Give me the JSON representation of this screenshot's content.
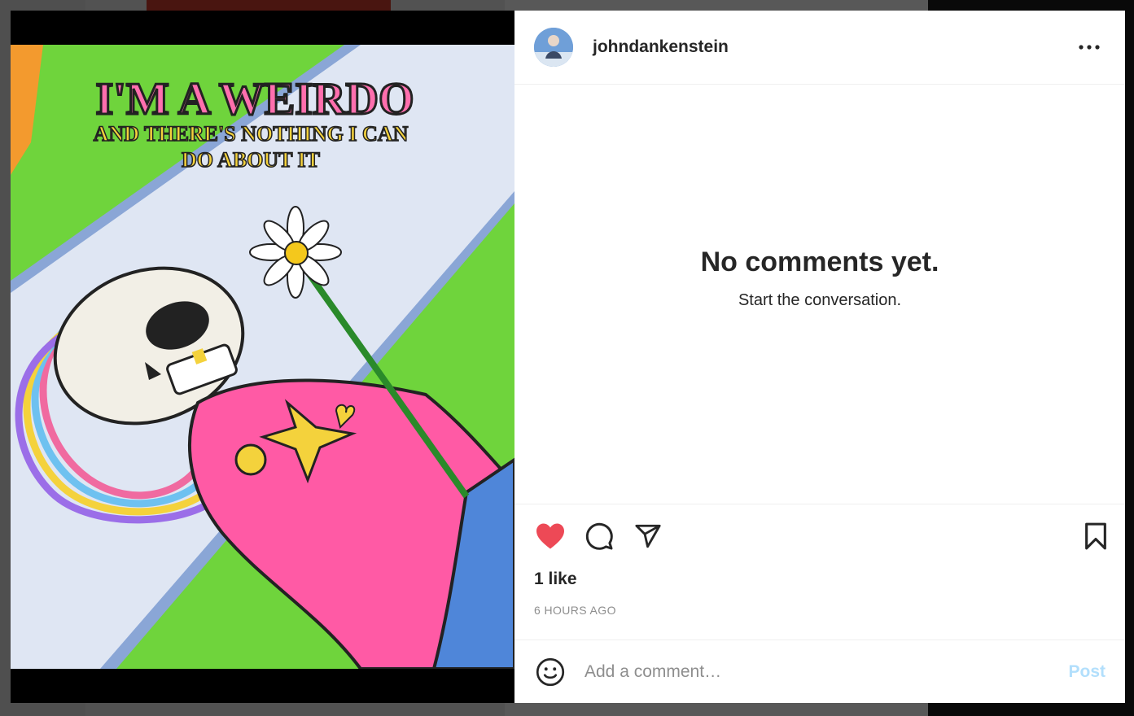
{
  "post": {
    "username": "johndankenstein",
    "avatar_icon": "user-avatar",
    "more_icon": "more-options-icon",
    "image_text": {
      "headline": "I'M A WEIRDO",
      "subline_1": "AND THERE'S NOTHING I CAN",
      "subline_2": "DO ABOUT IT"
    },
    "empty_comments": {
      "title": "No comments yet.",
      "subtitle": "Start the conversation."
    },
    "actions": {
      "like_icon": "heart-filled-icon",
      "comment_icon": "comment-icon",
      "share_icon": "share-icon",
      "save_icon": "bookmark-icon",
      "liked": true
    },
    "likes_text": "1 like",
    "timestamp": "6 HOURS AGO",
    "comment_box": {
      "placeholder": "Add a comment…",
      "post_label": "Post",
      "emoji_icon": "emoji-icon"
    }
  },
  "colors": {
    "like_red": "#ed4956",
    "post_disabled": "#b2dffc",
    "text_primary": "#262626",
    "text_secondary": "#8e8e8e"
  }
}
